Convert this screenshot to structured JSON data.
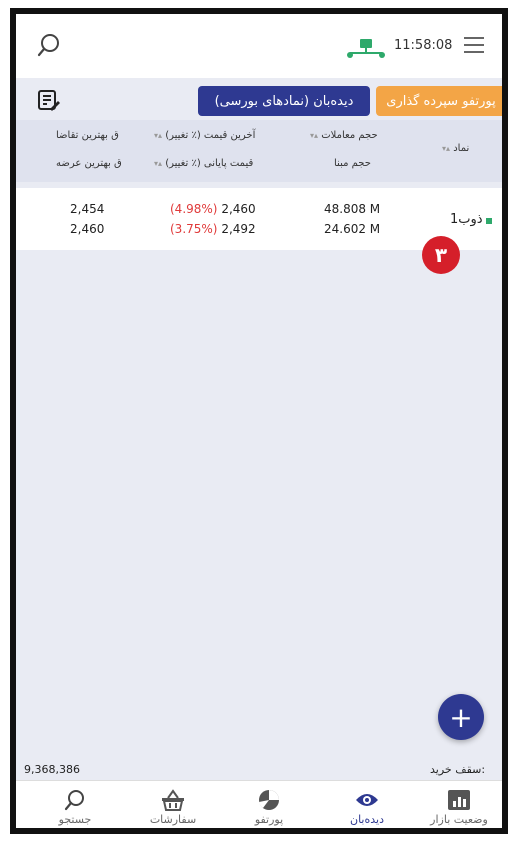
{
  "status": {
    "time": "11:58:08"
  },
  "tabs": {
    "portfolio_label": "پورتفو سپرده گذاری",
    "watch_label": "دیده‌بان (نمادهای بورسی)"
  },
  "table": {
    "headers": {
      "symbol": "نماد",
      "volume": "حجم معاملات",
      "base_volume": "حجم مبنا",
      "last_price": "آخرین قیمت (٪ تغییر)",
      "close_price": "قیمت پایانی (٪ تغییر)",
      "best_bid": "ق بهترین تقاضا",
      "best_ask": "ق بهترین عرضه",
      "sort_mark": "▾▴"
    },
    "rows": [
      {
        "symbol": "ذوب1",
        "volume": "48.808 M",
        "base_volume": "24.602 M",
        "last_price_pct": "(4.98%)",
        "last_price": "2,460",
        "close_price_pct": "(3.75%)",
        "close_price": "2,492",
        "best_bid": "2,454",
        "best_ask": "2,460"
      }
    ]
  },
  "badge": "۳",
  "fab": "+",
  "purchase": {
    "label": "سقف خرید:",
    "value": "9,368,386"
  },
  "nav": {
    "market": "وضعیت بازار",
    "watch": "دیده‌بان",
    "portfolio": "پورتفو",
    "orders": "سفارشات",
    "search": "جستجو"
  },
  "colors": {
    "primary": "#2e3991",
    "accent": "#f3a546",
    "negative": "#e03a3a",
    "badge": "#d51f2a"
  }
}
